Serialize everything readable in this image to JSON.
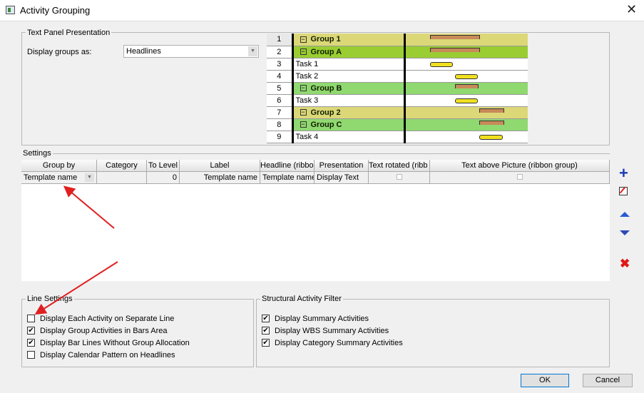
{
  "window": {
    "title": "Activity Grouping",
    "close": "✕"
  },
  "text_panel": {
    "legend": "Text Panel Presentation",
    "display_label": "Display groups as:",
    "display_value": "Headlines",
    "rows": [
      {
        "num": "1",
        "text": "Group 1",
        "kind": "group",
        "color": "#dcd878"
      },
      {
        "num": "2",
        "text": "Group A",
        "kind": "group",
        "color": "#9acd32"
      },
      {
        "num": "3",
        "text": "Task 1",
        "kind": "task",
        "color": "#ffffff"
      },
      {
        "num": "4",
        "text": "Task 2",
        "kind": "task",
        "color": "#ffffff"
      },
      {
        "num": "5",
        "text": "Group B",
        "kind": "group",
        "color": "#90d870"
      },
      {
        "num": "6",
        "text": "Task 3",
        "kind": "task",
        "color": "#ffffff"
      },
      {
        "num": "7",
        "text": "Group 2",
        "kind": "group",
        "color": "#dcd878"
      },
      {
        "num": "8",
        "text": "Group C",
        "kind": "group",
        "color": "#90d870"
      },
      {
        "num": "9",
        "text": "Task 4",
        "kind": "task",
        "color": "#ffffff"
      }
    ]
  },
  "settings": {
    "legend": "Settings",
    "columns": [
      "Group by",
      "Category",
      "To Level",
      "Label",
      "Headline (ribbon",
      "Presentation",
      "Text rotated (ribb",
      "Text above Picture (ribbon group)"
    ],
    "row": {
      "group_by": "Template name",
      "category": "",
      "to_level": "0",
      "label": "Template name",
      "headline": "Template name",
      "presentation": "Display Text",
      "text_rotated": false,
      "text_above": false
    }
  },
  "line_settings": {
    "legend": "Line Settings",
    "items": [
      {
        "label": "Display Each Activity on Separate Line",
        "checked": false
      },
      {
        "label": "Display Group Activities in Bars Area",
        "checked": true
      },
      {
        "label": "Display Bar Lines Without Group Allocation",
        "checked": true
      },
      {
        "label": "Display Calendar Pattern on Headlines",
        "checked": false
      }
    ]
  },
  "structural_filter": {
    "legend": "Structural Activity Filter",
    "items": [
      {
        "label": "Display Summary Activities",
        "checked": true
      },
      {
        "label": "Display WBS Summary Activities",
        "checked": true
      },
      {
        "label": "Display Category Summary Activities",
        "checked": true
      }
    ]
  },
  "buttons": {
    "ok": "OK",
    "cancel": "Cancel"
  },
  "side_icons": [
    "add-icon",
    "edit-icon",
    "move-up-icon",
    "move-down-icon",
    "delete-icon"
  ],
  "annotation_color": "#e02020"
}
